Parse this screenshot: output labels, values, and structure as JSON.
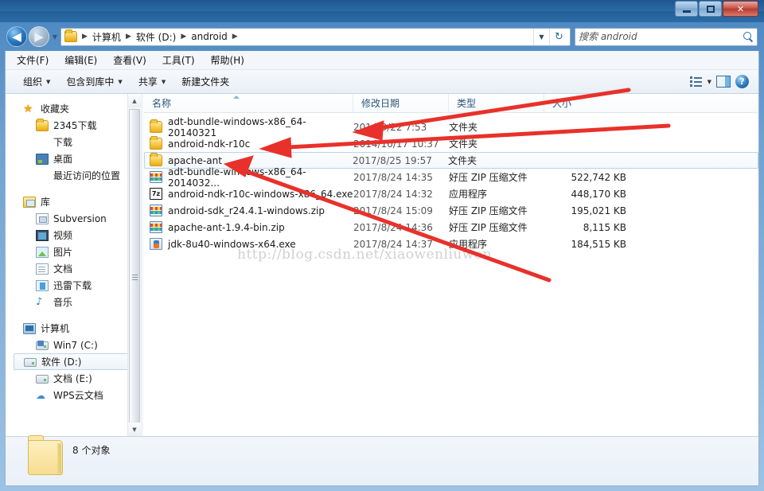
{
  "window": {
    "minimize_label": "最小化",
    "maximize_label": "最大化",
    "close_label": "✕"
  },
  "address": {
    "back_label": "◀",
    "forward_label": "▶",
    "history_label": "▼",
    "crumbs": [
      "计算机",
      "软件 (D:)",
      "android"
    ],
    "separator": "▶",
    "dropdown_label": "▼",
    "refresh_label": "↻"
  },
  "search": {
    "placeholder": "搜索 android",
    "value": ""
  },
  "menubar": {
    "items": [
      "文件(F)",
      "编辑(E)",
      "查看(V)",
      "工具(T)",
      "帮助(H)"
    ]
  },
  "toolbar": {
    "organize_label": "组织",
    "include_label": "包含到库中",
    "share_label": "共享",
    "newfolder_label": "新建文件夹",
    "caret": "▼",
    "help_label": "?"
  },
  "sidebar": {
    "groups": [
      {
        "header": "收藏夹",
        "header_icon": "star-icon",
        "items": [
          {
            "label": "2345下载",
            "icon": "folder-icon"
          },
          {
            "label": "下载",
            "icon": "folder-icon"
          },
          {
            "label": "桌面",
            "icon": "desktop-icon"
          },
          {
            "label": "最近访问的位置",
            "icon": "recent-icon"
          }
        ]
      },
      {
        "header": "库",
        "header_icon": "library-icon",
        "items": [
          {
            "label": "Subversion",
            "icon": "subversion-icon"
          },
          {
            "label": "视频",
            "icon": "video-icon"
          },
          {
            "label": "图片",
            "icon": "picture-icon"
          },
          {
            "label": "文档",
            "icon": "document-icon"
          },
          {
            "label": "迅雷下载",
            "icon": "thunder-icon"
          },
          {
            "label": "音乐",
            "icon": "music-icon"
          }
        ]
      },
      {
        "header": "计算机",
        "header_icon": "computer-icon",
        "items": [
          {
            "label": "Win7 (C:)",
            "icon": "system-drive-icon",
            "selected": false
          },
          {
            "label": "软件 (D:)",
            "icon": "drive-icon",
            "selected": true
          },
          {
            "label": "文档 (E:)",
            "icon": "drive-icon",
            "selected": false
          },
          {
            "label": "WPS云文档",
            "icon": "cloud-icon",
            "selected": false
          }
        ]
      }
    ],
    "scroll_up": "▲",
    "scroll_down": "▼"
  },
  "filelist": {
    "columns": [
      "名称",
      "修改日期",
      "类型",
      "大小"
    ],
    "sort_column": "名称",
    "sort_direction": "asc",
    "rows": [
      {
        "name": "adt-bundle-windows-x86_64-20140321",
        "date": "2014/3/22 7:53",
        "type": "文件夹",
        "size": "",
        "icon": "folder-icon",
        "selected": false
      },
      {
        "name": "android-ndk-r10c",
        "date": "2014/10/17 10:37",
        "type": "文件夹",
        "size": "",
        "icon": "folder-icon",
        "selected": false
      },
      {
        "name": "apache-ant",
        "date": "2017/8/25 19:57",
        "type": "文件夹",
        "size": "",
        "icon": "folder-icon",
        "selected": true
      },
      {
        "name": "adt-bundle-windows-x86_64-2014032...",
        "date": "2017/8/24 14:35",
        "type": "好压 ZIP 压缩文件",
        "size": "522,742 KB",
        "icon": "zip-icon",
        "selected": false
      },
      {
        "name": "android-ndk-r10c-windows-x86_64.exe",
        "date": "2017/8/24 14:32",
        "type": "应用程序",
        "size": "448,170 KB",
        "icon": "sevenzip-icon",
        "selected": false
      },
      {
        "name": "android-sdk_r24.4.1-windows.zip",
        "date": "2017/8/24 15:09",
        "type": "好压 ZIP 压缩文件",
        "size": "195,021 KB",
        "icon": "zip-icon",
        "selected": false
      },
      {
        "name": "apache-ant-1.9.4-bin.zip",
        "date": "2017/8/24 14:36",
        "type": "好压 ZIP 压缩文件",
        "size": "8,115 KB",
        "icon": "zip-icon",
        "selected": false
      },
      {
        "name": "jdk-8u40-windows-x64.exe",
        "date": "2017/8/24 14:37",
        "type": "应用程序",
        "size": "184,515 KB",
        "icon": "java-icon",
        "selected": false
      }
    ]
  },
  "statusbar": {
    "text": "8 个对象"
  },
  "watermark": {
    "text": "http://blog.csdn.net/xiaowenliuwen"
  },
  "annotations": {
    "color": "#e8312a",
    "arrows": [
      {
        "target": "adt-bundle-windows-x86_64-20140321"
      },
      {
        "target": "android-ndk-r10c"
      },
      {
        "target": "apache-ant"
      }
    ]
  }
}
